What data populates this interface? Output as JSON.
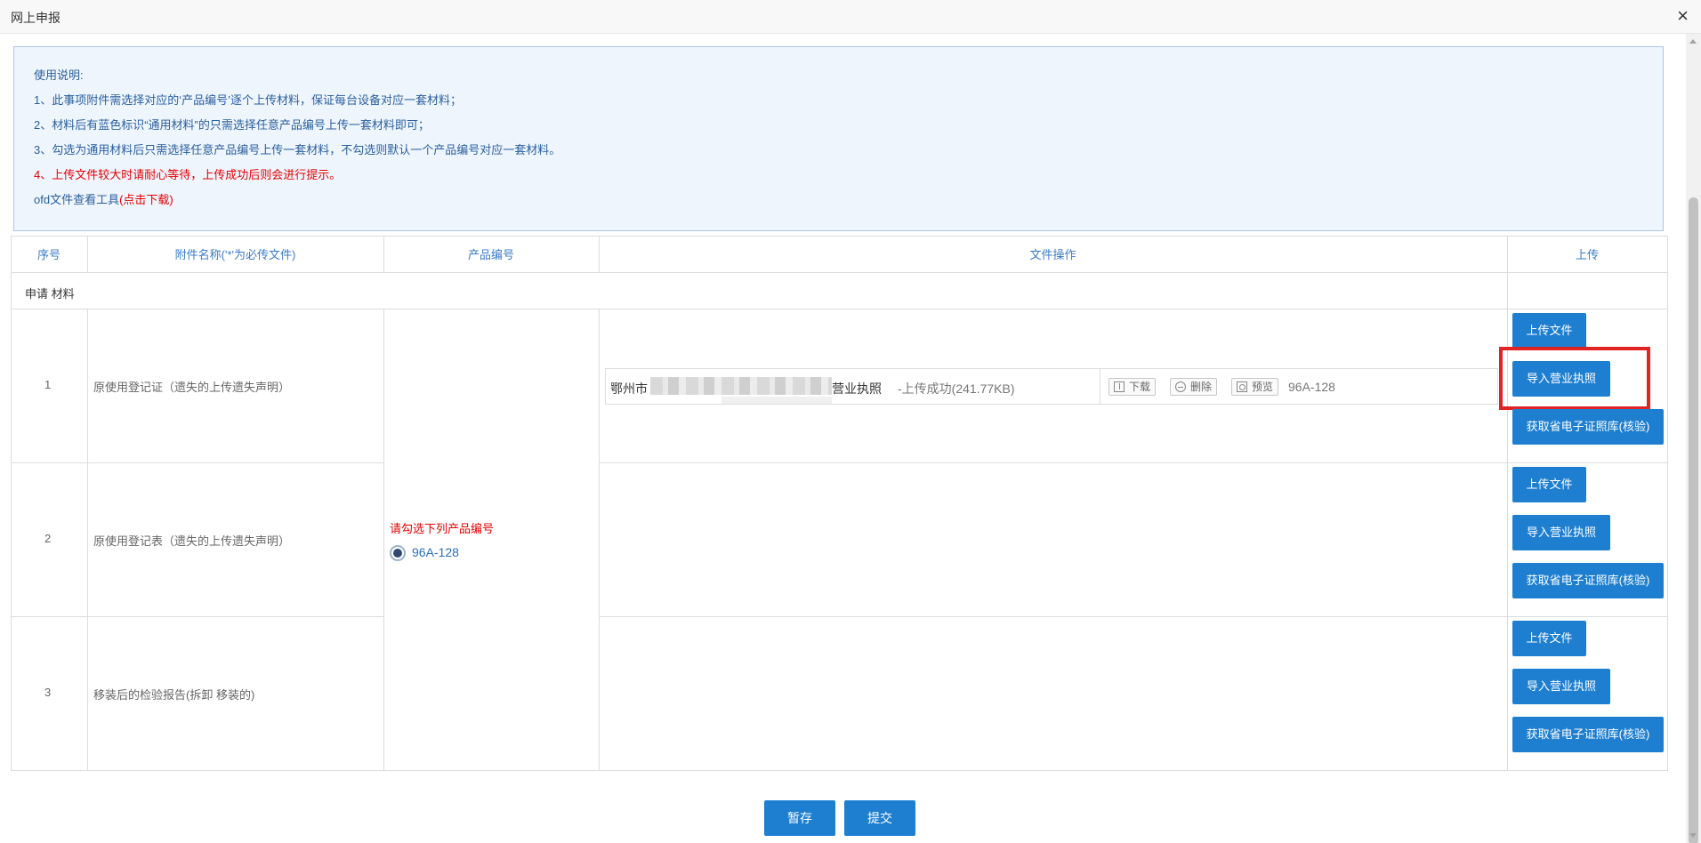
{
  "window": {
    "title": "网上申报",
    "close_icon": "×"
  },
  "instructions": {
    "heading": "使用说明:",
    "line1": "1、此事项附件需选择对应的‘产品编号’逐个上传材料，保证每台设备对应一套材料；",
    "line2": "2、材料后有蓝色标识“通用材料”的只需选择任意产品编号上传一套材料即可；",
    "line3": "3、勾选为通用材料后只需选择任意产品编号上传一套材料，不勾选则默认一个产品编号对应一套材料。",
    "line4": "4、上传文件较大时请耐心等待，上传成功后则会进行提示。",
    "tool_text": "ofd文件查看工具",
    "tool_link": "(点击下载)"
  },
  "table": {
    "headers": [
      "序号",
      "附件名称('*'为必传文件)",
      "产品编号",
      "文件操作",
      "上传"
    ],
    "section_label": "申请 材料",
    "rows": [
      {
        "index": "1",
        "name": "原使用登记证（遗失的上传遗失声明）"
      },
      {
        "index": "2",
        "name": "原使用登记表（遗失的上传遗失声明）"
      },
      {
        "index": "3",
        "name": "移装后的检验报告(拆卸 移装的)"
      }
    ],
    "product": {
      "prompt": "请勾选下列产品编号",
      "option": "96A-128"
    },
    "file": {
      "name_prefix": "鄂州市",
      "name_suffix": "营业执照",
      "status": "-上传成功(241.77KB)",
      "download": "下载",
      "delete": "删除",
      "preview": "预览",
      "code": "96A-128"
    },
    "buttons": {
      "upload": "上传文件",
      "import_license": "导入营业执照",
      "fetch_ecert": "获取省电子证照库(核验)"
    }
  },
  "footer": {
    "save": "暂存",
    "submit": "提交"
  },
  "colors": {
    "accent": "#1e7fd1",
    "warning": "#e60000",
    "highlight": "#e02424",
    "info_bg": "#eef5fd"
  }
}
